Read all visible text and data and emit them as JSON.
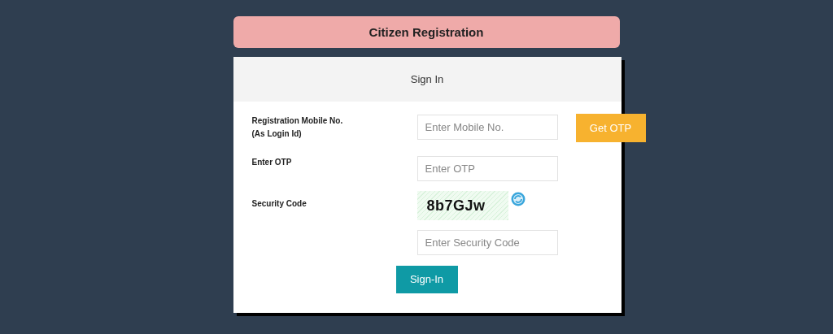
{
  "banner": {
    "title": "Citizen Registration"
  },
  "form": {
    "heading": "Sign In",
    "rows": [
      {
        "kind": "input",
        "label": "Registration Mobile No.\n(As Login Id)",
        "placeholder": "Enter Mobile No.",
        "action": "Get OTP"
      },
      {
        "kind": "input",
        "label": "Enter OTP",
        "placeholder": "Enter OTP"
      },
      {
        "kind": "captcha",
        "label": "Security Code",
        "code": "8b7GJw"
      },
      {
        "kind": "input",
        "placeholder": "Enter Security Code"
      }
    ],
    "submit": "Sign-In"
  }
}
